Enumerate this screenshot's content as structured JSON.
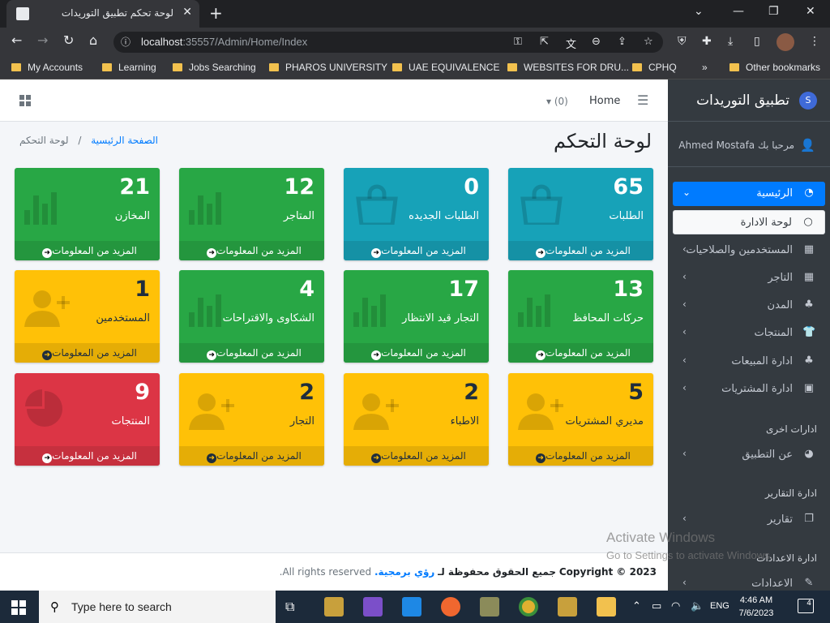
{
  "browser": {
    "tab_title": "لوحة تحكم تطبيق التوريدات",
    "url_host": "localhost",
    "url_rest": ":35557/Admin/Home/Index",
    "bookmarks": [
      "My Accounts",
      "Learning",
      "Jobs Searching",
      "PHAROS UNIVERSITY",
      "UAE EQUIVALENCE",
      "WEBSITES FOR DRU...",
      "CPHQ"
    ],
    "more": "»",
    "other_bookmarks": "Other bookmarks"
  },
  "topnav": {
    "home": "Home",
    "count": "(0)"
  },
  "page": {
    "title": "لوحة التحكم",
    "breadcrumb_home": "الصفحة الرئيسية",
    "breadcrumb_sep": "/",
    "breadcrumb_current": "لوحة التحكم"
  },
  "more_info": "المزيد من المعلومات",
  "cards": [
    {
      "num": "65",
      "label": "الطلبات",
      "color": "#17a2b8",
      "icon": "shopping-bag-icon"
    },
    {
      "num": "0",
      "label": "الطلبات الجديده",
      "color": "#17a2b8",
      "icon": "shopping-bag-icon"
    },
    {
      "num": "12",
      "label": "المتاجر",
      "color": "#28a745",
      "icon": "bar-chart-icon"
    },
    {
      "num": "21",
      "label": "المخازن",
      "color": "#28a745",
      "icon": "bar-chart-icon"
    },
    {
      "num": "13",
      "label": "حركات المحافظ",
      "color": "#28a745",
      "icon": "bar-chart-icon"
    },
    {
      "num": "17",
      "label": "التجار قيد الانتظار",
      "color": "#28a745",
      "icon": "bar-chart-icon"
    },
    {
      "num": "4",
      "label": "الشكاوى والاقتراحات",
      "color": "#28a745",
      "icon": "bar-chart-icon"
    },
    {
      "num": "1",
      "label": "المستخدمين",
      "color": "#ffc107",
      "icon": "user-plus-icon"
    },
    {
      "num": "5",
      "label": "مديري المشتريات",
      "color": "#ffc107",
      "icon": "user-plus-icon"
    },
    {
      "num": "2",
      "label": "الاطباء",
      "color": "#ffc107",
      "icon": "user-plus-icon"
    },
    {
      "num": "2",
      "label": "التجار",
      "color": "#ffc107",
      "icon": "user-plus-icon"
    },
    {
      "num": "9",
      "label": "المنتجات",
      "color": "#dc3545",
      "icon": "pie-chart-icon"
    }
  ],
  "footer": {
    "copyright": "Copyright © 2023",
    "rights": "جميع الحقوق محفوظة لـ",
    "brand": "رؤي برمجية.",
    "reserved": "All rights reserved."
  },
  "sidebar": {
    "brand": "تطبيق التوريدات",
    "brand_logo": "S",
    "greeting": "مرحبا بك",
    "user": "Ahmed Mostafa",
    "items": [
      {
        "label": "الرئيسية",
        "icon": "dashboard-icon"
      },
      {
        "label": "لوحة الادارة",
        "icon": "circle-icon"
      },
      {
        "label": "المستخدمين والصلاحيات",
        "icon": "calendar-icon"
      },
      {
        "label": "التاجر",
        "icon": "calendar-icon"
      },
      {
        "label": "المدن",
        "icon": "tree-icon"
      },
      {
        "label": "المنتجات",
        "icon": "shirt-icon"
      },
      {
        "label": "ادارة المبيعات",
        "icon": "tree-icon"
      },
      {
        "label": "ادارة المشتريات",
        "icon": "box-icon"
      }
    ],
    "header_other": "ادارات اخرى",
    "about": "عن التطبيق",
    "header_reports": "ادارة التقارير",
    "reports": "تقارير",
    "header_settings": "ادارة الاعدادات",
    "settings": "الاعدادات"
  },
  "watermark": {
    "line1": "Activate Windows",
    "line2": "Go to Settings to activate Windows."
  },
  "taskbar": {
    "search_placeholder": "Type here to search",
    "lang": "ENG",
    "time": "4:46 AM",
    "date": "7/6/2023",
    "notifications": "4"
  }
}
